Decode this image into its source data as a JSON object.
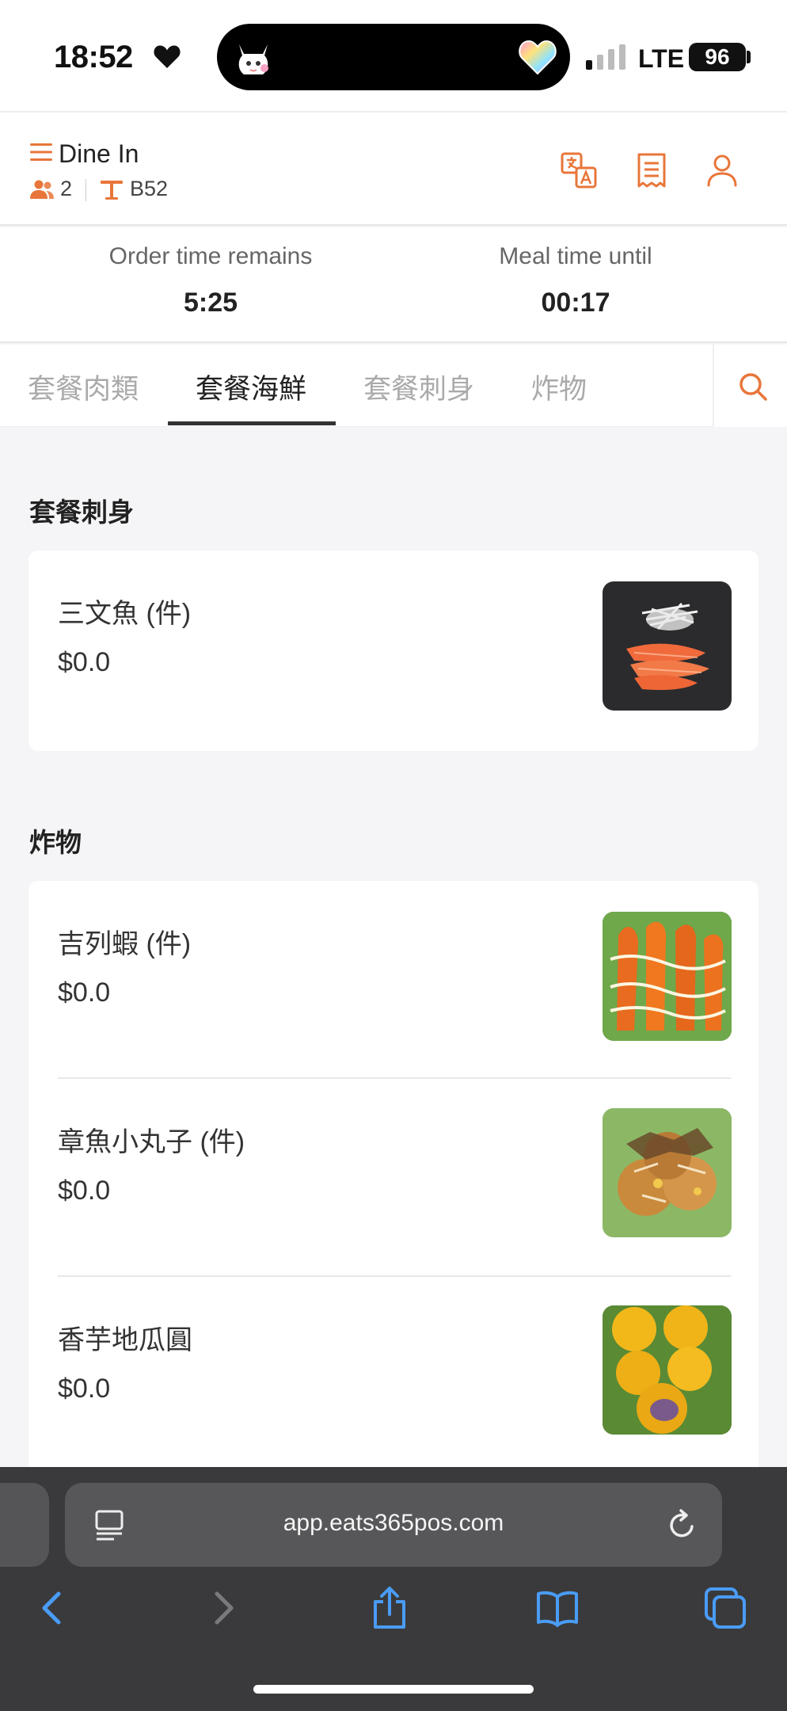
{
  "status_bar": {
    "time": "18:52",
    "network": "LTE",
    "battery": "96"
  },
  "header": {
    "mode_label": "Dine In",
    "guest_count": "2",
    "table_name": "B52"
  },
  "timers": {
    "order_label": "Order time remains",
    "order_value": "5:25",
    "meal_label": "Meal time until",
    "meal_value": "00:17"
  },
  "tabs": [
    {
      "label": "套餐肉類",
      "active": false
    },
    {
      "label": "套餐海鮮",
      "active": true
    },
    {
      "label": "套餐刺身",
      "active": false
    },
    {
      "label": "炸物",
      "active": false
    }
  ],
  "sections": [
    {
      "title": "套餐刺身",
      "items": [
        {
          "name": "三文魚 (件)",
          "price": "$0.0"
        }
      ]
    },
    {
      "title": "炸物",
      "items": [
        {
          "name": "吉列蝦 (件)",
          "price": "$0.0"
        },
        {
          "name": "章魚小丸子 (件)",
          "price": "$0.0"
        },
        {
          "name": "香芋地瓜圓",
          "price": "$0.0"
        }
      ]
    }
  ],
  "browser": {
    "url": "app.eats365pos.com"
  },
  "colors": {
    "accent": "#e8763a"
  }
}
